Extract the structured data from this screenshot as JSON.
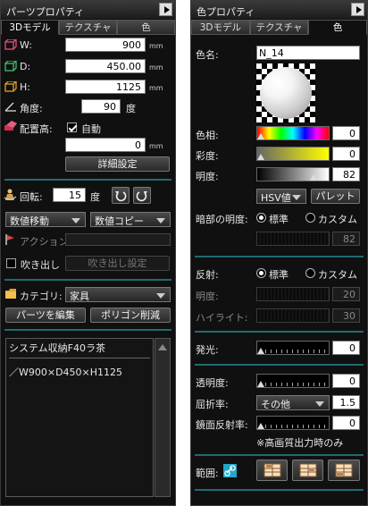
{
  "parts_panel": {
    "title": "パーツプロパティ",
    "tabs": [
      "3Dモデル",
      "テクスチャ",
      "色"
    ],
    "width_label": "W:",
    "width_value": "900",
    "depth_label": "D:",
    "depth_value": "450.00",
    "height_label": "H:",
    "height_value": "1125",
    "unit_mm": "mm",
    "angle_label": "角度:",
    "angle_value": "90",
    "angle_unit": "度",
    "elevation_label": "配置高:",
    "auto_label": "自動",
    "auto_checked": true,
    "elevation_value": "0",
    "detail_button": "詳細設定",
    "rotation_label": "回転:",
    "rotation_value": "15",
    "rotation_unit": "度",
    "move_select": "数値移動",
    "copy_select": "数値コピー",
    "action_label": "アクション:",
    "balloon_label": "吹き出し",
    "balloon_checked": false,
    "balloon_button": "吹き出し設定",
    "category_label": "カテゴリ:",
    "category_value": "家具",
    "edit_parts_button": "パーツを編集",
    "delete_polygon_button": "ポリゴン削減",
    "info_line1": "システム収納F40ラ茶",
    "info_line2": "／W900×D450×H1125",
    "accent_color": "#1f6b72"
  },
  "color_panel": {
    "title": "色プロパティ",
    "tabs": [
      "3Dモデル",
      "テクスチャ",
      "色"
    ],
    "color_name_label": "色名:",
    "color_name_value": "N_14",
    "hue_label": "色相:",
    "hue_value": "0",
    "saturation_label": "彩度:",
    "saturation_value": "0",
    "brightness_label": "明度:",
    "brightness_value": "82",
    "hsv_select": "HSV値",
    "palette_button": "パレット",
    "dark_brightness_label": "暗部の明度:",
    "standard_label": "標準",
    "custom_label": "カスタム",
    "dark_value": "82",
    "reflection_label": "反射:",
    "reflection_standard": "標準",
    "reflection_custom": "カスタム",
    "refl_brightness_label": "明度:",
    "refl_brightness_value": "20",
    "highlight_label": "ハイライト:",
    "highlight_value": "30",
    "emission_label": "発光:",
    "emission_value": "0",
    "transparency_label": "透明度:",
    "transparency_value": "0",
    "refraction_label": "屈折率:",
    "refraction_select": "その他",
    "refraction_value": "1.5",
    "mirror_label": "鏡面反射率:",
    "mirror_value": "0",
    "note": "※高画質出力時のみ",
    "range_label": "範囲:"
  }
}
